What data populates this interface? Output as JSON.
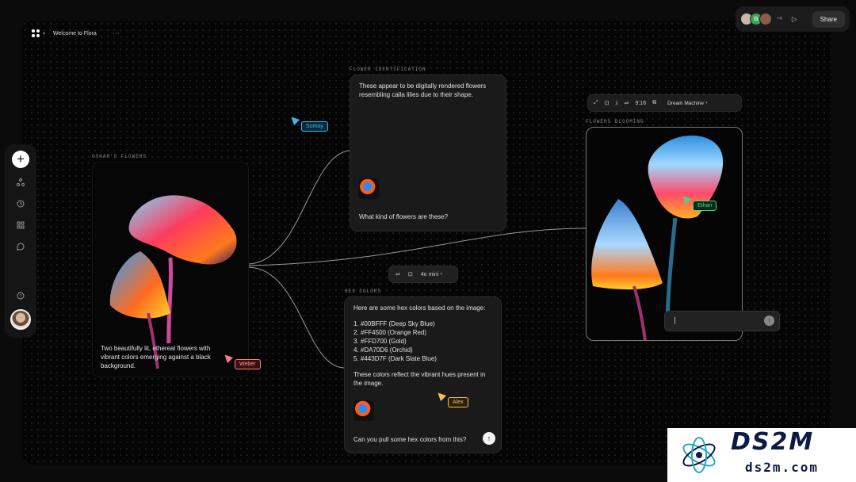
{
  "header": {
    "title": "Welcome to Flora",
    "menu": "···"
  },
  "collab": {
    "avatars": [
      {
        "initial": "",
        "color": "#c9b8a8"
      },
      {
        "initial": "G",
        "color": "#3aa655"
      },
      {
        "initial": "",
        "color": "#8a5a4a"
      }
    ],
    "more_count": "+4",
    "share_label": "Share"
  },
  "sidebar": {
    "add": "+"
  },
  "oskar": {
    "label": "OSKAR'S FLOWERS",
    "caption": "Two beautifully lit, ethereal flowers with vibrant colors emerging against a black background."
  },
  "identification": {
    "label": "FLOWER IDENTIFICATION",
    "answer": "These appear to be digitally rendered flowers resembling calla lilies due to their shape.",
    "question": "What kind of flowers are these?"
  },
  "mini_toolbar": {
    "model": "4o mini"
  },
  "hex": {
    "label": "HEX COLORS",
    "intro": "Here are some hex colors based on the image:",
    "items": [
      "1. #00BFFF (Deep Sky Blue)",
      "2. #FF4500 (Orange Red)",
      "3. #FFD700 (Gold)",
      "4. #DA70D6 (Orchid)",
      "5. #443D7F (Dark Slate Blue)"
    ],
    "outro": "These colors reflect the vibrant hues present in the image.",
    "question": "Can you pull some hex colors from this?"
  },
  "bloom": {
    "label": "FLOWERS BLOOMING",
    "ratio": "9:16",
    "model": "Dream Machine"
  },
  "cursors": [
    {
      "name": "Somay",
      "color": "#3fb6e8"
    },
    {
      "name": "Weber",
      "color": "#ff7a7a"
    },
    {
      "name": "Ethan",
      "color": "#4fd18b"
    },
    {
      "name": "Alex",
      "color": "#f2c14e"
    }
  ],
  "watermark": {
    "title": "DS2M",
    "subtitle": "ds2m.com"
  },
  "colors": {
    "accent_blue": "#00BFFF",
    "accent_orange": "#FF4500",
    "canvas": "#050505"
  }
}
